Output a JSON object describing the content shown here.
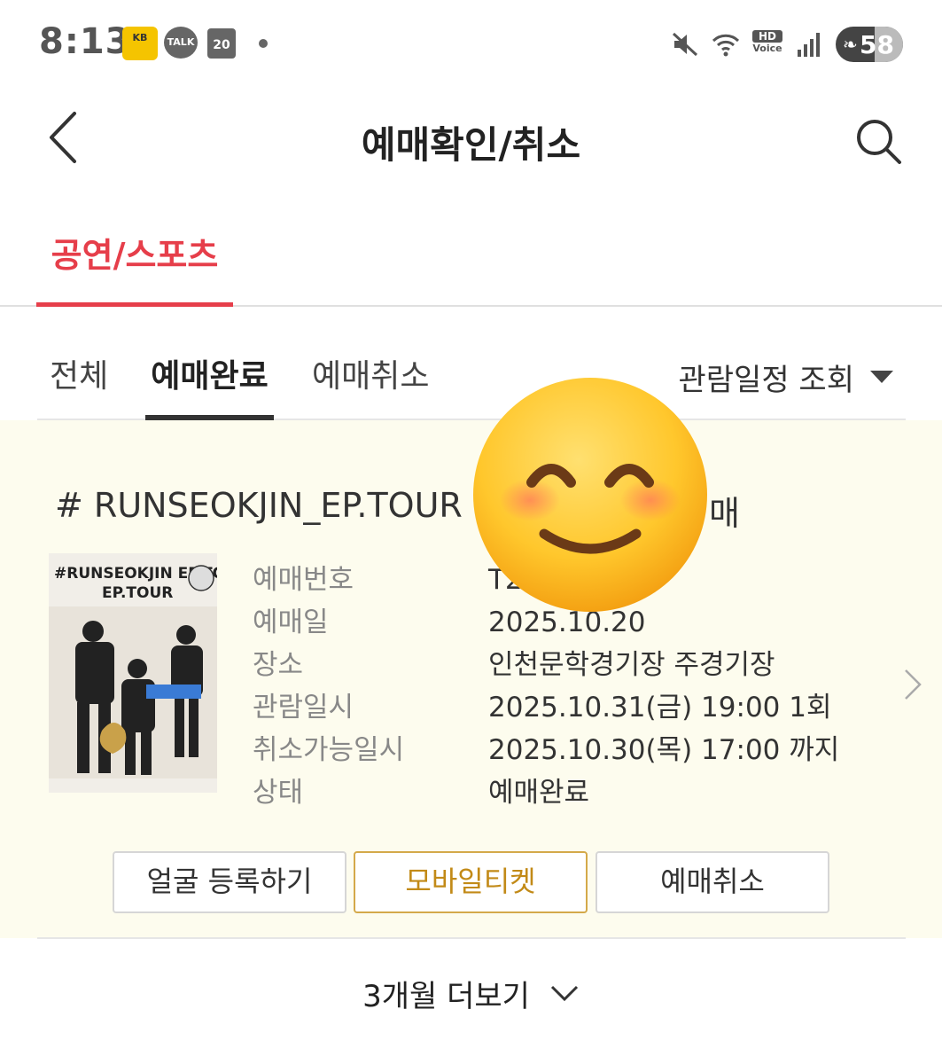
{
  "status_bar": {
    "time": "8:13",
    "kb_label": "KB",
    "talk_label": "TALK",
    "calendar_day": "20",
    "hd_label": "HD",
    "voice_label": "Voice",
    "battery": "58",
    "battery_level_percent": 58
  },
  "header": {
    "title": "예매확인/취소"
  },
  "category_tabs": [
    {
      "label": "공연/스포츠",
      "active": true
    }
  ],
  "filter_tabs": {
    "all": "전체",
    "completed": "예매완료",
    "cancelled": "예매취소",
    "active": "completed"
  },
  "date_filter": {
    "label": "관람일정 조회"
  },
  "booking": {
    "title": "# RUNSEOKJIN_EP.TOUR",
    "title_tail": "매",
    "poster_text": "#RUNSEOKJIN EP.TOUR",
    "rows": [
      {
        "label": "예매번호",
        "value": "T2"
      },
      {
        "label": "예매일",
        "value": "2025.10.20"
      },
      {
        "label": "장소",
        "value": "인천문학경기장 주경기장"
      },
      {
        "label": "관람일시",
        "value": "2025.10.31(금) 19:00 1회"
      },
      {
        "label": "취소가능일시",
        "value": "2025.10.30(목) 17:00 까지"
      },
      {
        "label": "상태",
        "value": "예매완료"
      }
    ],
    "buttons": {
      "face_register": "얼굴 등록하기",
      "mobile_ticket": "모바일티켓",
      "cancel": "예매취소"
    }
  },
  "more": {
    "label": "3개월 더보기"
  },
  "colors": {
    "accent": "#e63e4a",
    "card_bg": "#fdfcee",
    "mobile_ticket": "#c28a17"
  }
}
